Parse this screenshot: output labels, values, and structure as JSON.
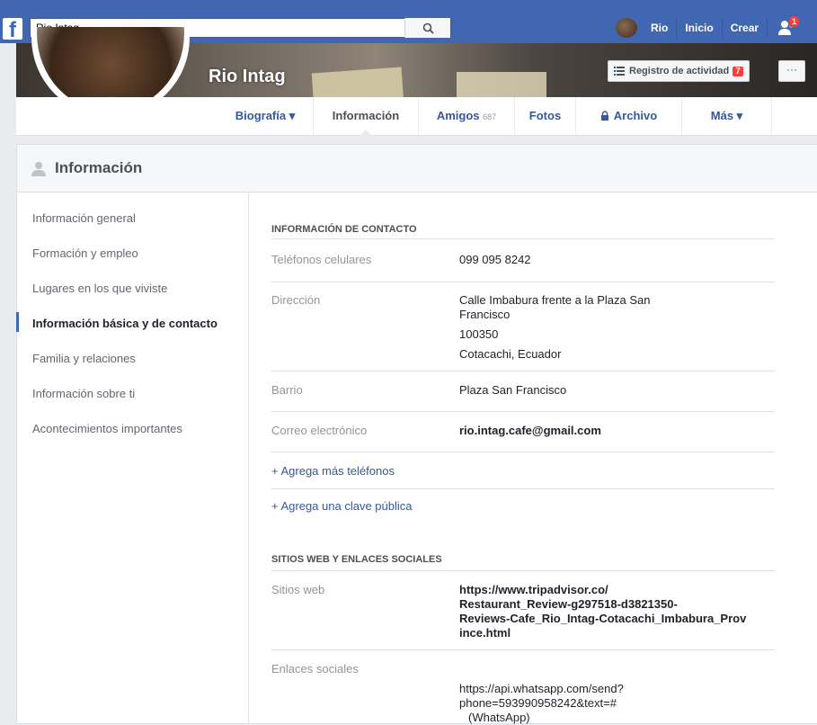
{
  "topbar": {
    "search_value": "Rio Intag",
    "user": "Rio",
    "home": "Inicio",
    "create": "Crear",
    "friend_requests_badge": "1"
  },
  "page": {
    "name": "Rio Intag",
    "activity_log": "Registro de actividad",
    "activity_count": "7",
    "more": "···"
  },
  "tabs": [
    {
      "label": "Biografía ▾"
    },
    {
      "label": "Información"
    },
    {
      "label": "Amigos",
      "sub": "687"
    },
    {
      "label": "Fotos"
    },
    {
      "label": "Archivo"
    },
    {
      "label": "Más ▾"
    }
  ],
  "about": {
    "title": "Información",
    "nav": [
      "Información general",
      "Formación y empleo",
      "Lugares en los que viviste",
      "Información básica y de contacto",
      "Familia y relaciones",
      "Información sobre ti",
      "Acontecimientos importantes"
    ],
    "contact": {
      "section": "INFORMACIÓN DE CONTACTO",
      "phones_label": "Teléfonos celulares",
      "phone": "099 095 8242",
      "address_label": "Dirección",
      "address_line1": "Calle Imbabura frente a la Plaza San",
      "address_line2": "Francisco",
      "postal": "100350",
      "city": "Cotacachi, Ecuador",
      "neighborhood_label": "Barrio",
      "neighborhood": "Plaza San Francisco",
      "email_label": "Correo electrónico",
      "email": "rio.intag.cafe@gmail.com",
      "add_phones": "+ Agrega más teléfonos",
      "add_key": "+ Agrega una clave pública"
    },
    "web": {
      "section": "SITIOS WEB Y ENLACES SOCIALES",
      "websites_label": "Sitios web",
      "website_line1": "https://www.tripadvisor.co/",
      "website_line2": "Restaurant_Review-g297518-d3821350-",
      "website_line3": "Reviews-Cafe_Rio_Intag-Cotacachi_Imbabura_Prov",
      "website_line4": "ince.html",
      "social_label": "Enlaces sociales",
      "social_line1": "https://api.whatsapp.com/send?",
      "social_line2": "phone=593990958242&text=#",
      "social_line3": "(WhatsApp)"
    }
  }
}
